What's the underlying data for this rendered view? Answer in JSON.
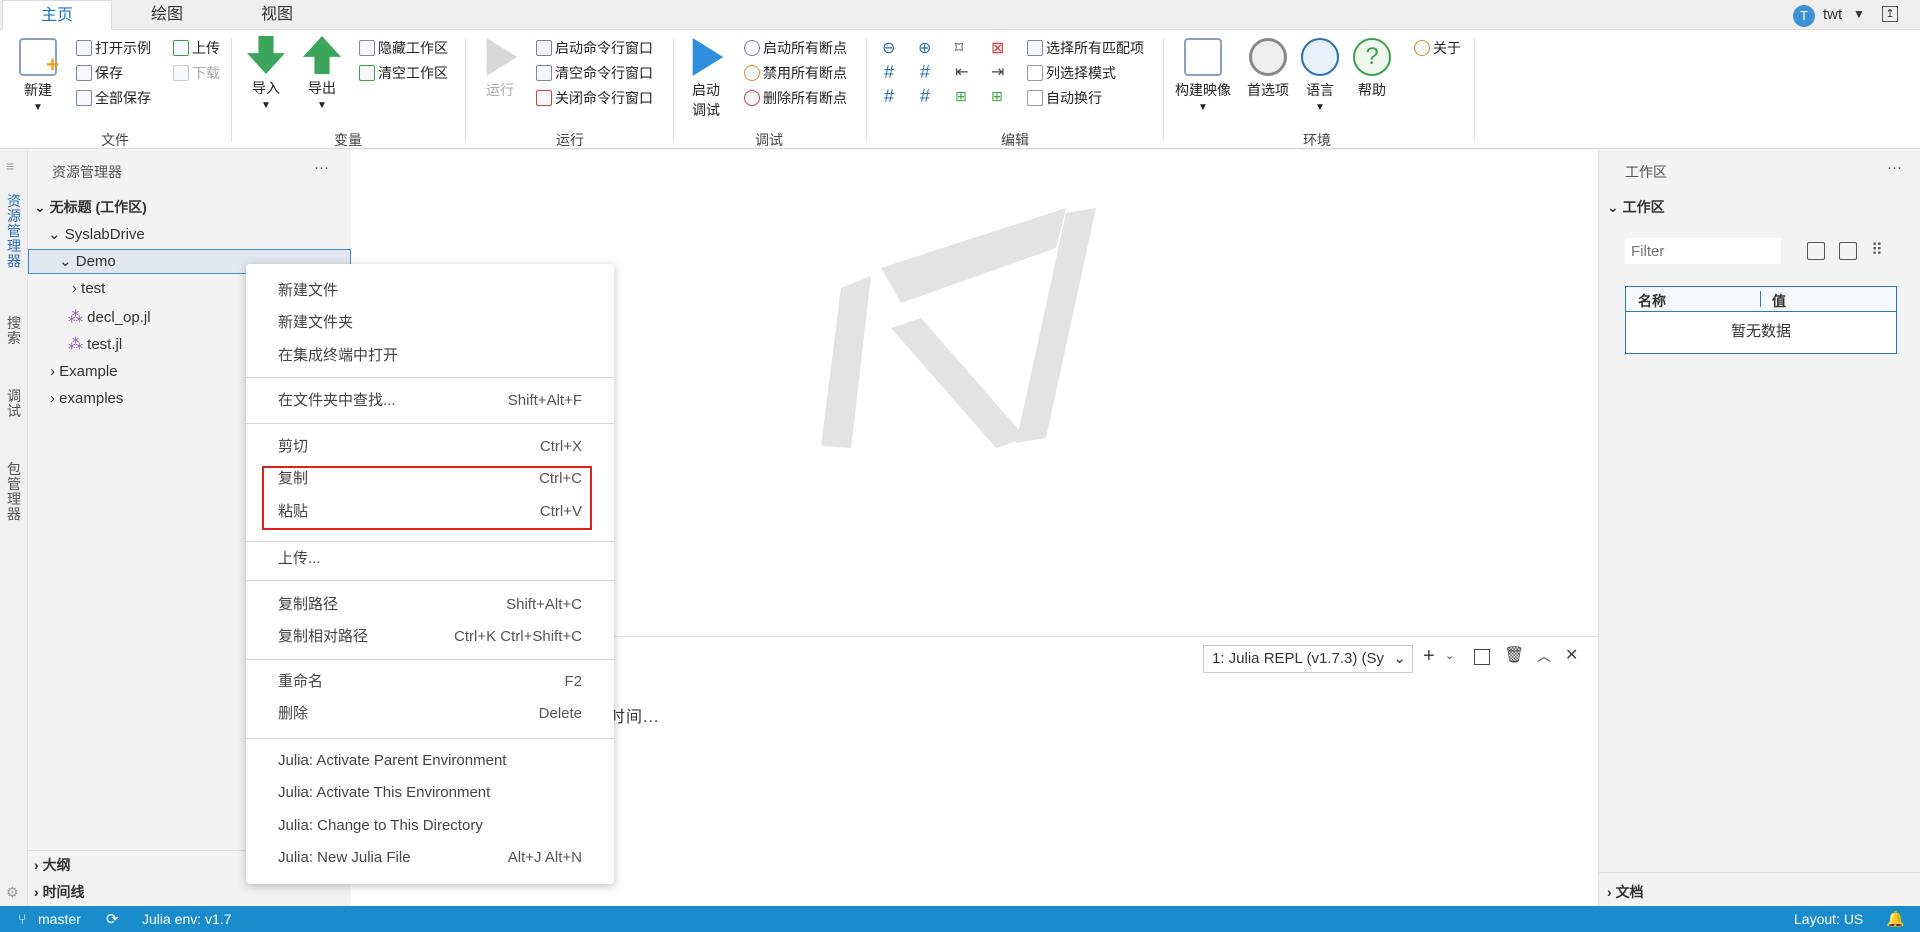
{
  "tabs": [
    "主页",
    "绘图",
    "视图"
  ],
  "user": {
    "initial": "T",
    "name": "twt"
  },
  "ribbon": {
    "file": {
      "new": "新建",
      "open_example": "打开示例",
      "save": "保存",
      "save_all": "全部保存",
      "upload": "上传",
      "download": "下载",
      "group": "文件"
    },
    "variables": {
      "import": "导入",
      "export": "导出",
      "hide_ws": "隐藏工作区",
      "clear_ws": "清空工作区",
      "group": "变量"
    },
    "run": {
      "run": "运行",
      "start_cmd": "启动命令行窗口",
      "clear_cmd": "清空命令行窗口",
      "close_cmd": "关闭命令行窗口",
      "group": "运行"
    },
    "debug": {
      "start_debug_1": "启动",
      "start_debug_2": "调试",
      "enable_bp": "启动所有断点",
      "disable_bp": "禁用所有断点",
      "delete_bp": "删除所有断点",
      "group": "调试"
    },
    "edit": {
      "select_all_matches": "选择所有匹配项",
      "column_mode": "列选择模式",
      "word_wrap": "自动换行",
      "group": "编辑"
    },
    "env": {
      "build_image": "构建映像",
      "preferences": "首选项",
      "language": "语言",
      "help": "帮助",
      "about": "关于",
      "group": "环境"
    }
  },
  "activity": {
    "explorer": "资源管理器",
    "search": "搜索",
    "debug": "调试",
    "pkg": "包管理器"
  },
  "explorer": {
    "title": "资源管理器",
    "more": "···",
    "root": "无标题 (工作区)",
    "items": [
      "SyslabDrive",
      "Demo",
      "test",
      "decl_op.jl",
      "test.jl",
      "Example",
      "examples"
    ],
    "outline": "大纲",
    "timeline": "时间线"
  },
  "panel": {
    "terminal_select": "1: Julia REPL (v1.7.3) (Sy",
    "content_fragment": "时间..."
  },
  "workspace": {
    "title": "工作区",
    "section": "工作区",
    "filter_placeholder": "Filter",
    "col_name": "名称",
    "col_value": "值",
    "empty": "暂无数据",
    "docs": "文档"
  },
  "status": {
    "branch": "master",
    "env": "Julia env: v1.7",
    "layout": "Layout: US"
  },
  "context_menu": {
    "new_file": "新建文件",
    "new_folder": "新建文件夹",
    "open_terminal": "在集成终端中打开",
    "find_in_folder": "在文件夹中查找...",
    "find_in_folder_kb": "Shift+Alt+F",
    "cut": "剪切",
    "cut_kb": "Ctrl+X",
    "copy": "复制",
    "copy_kb": "Ctrl+C",
    "paste": "粘贴",
    "paste_kb": "Ctrl+V",
    "upload": "上传...",
    "copy_path": "复制路径",
    "copy_path_kb": "Shift+Alt+C",
    "copy_rel_path": "复制相对路径",
    "copy_rel_path_kb": "Ctrl+K Ctrl+Shift+C",
    "rename": "重命名",
    "rename_kb": "F2",
    "delete": "删除",
    "delete_kb": "Delete",
    "julia_parent": "Julia: Activate Parent Environment",
    "julia_this": "Julia: Activate This Environment",
    "julia_cd": "Julia: Change to This Directory",
    "julia_new": "Julia: New Julia File",
    "julia_new_kb": "Alt+J Alt+N"
  }
}
